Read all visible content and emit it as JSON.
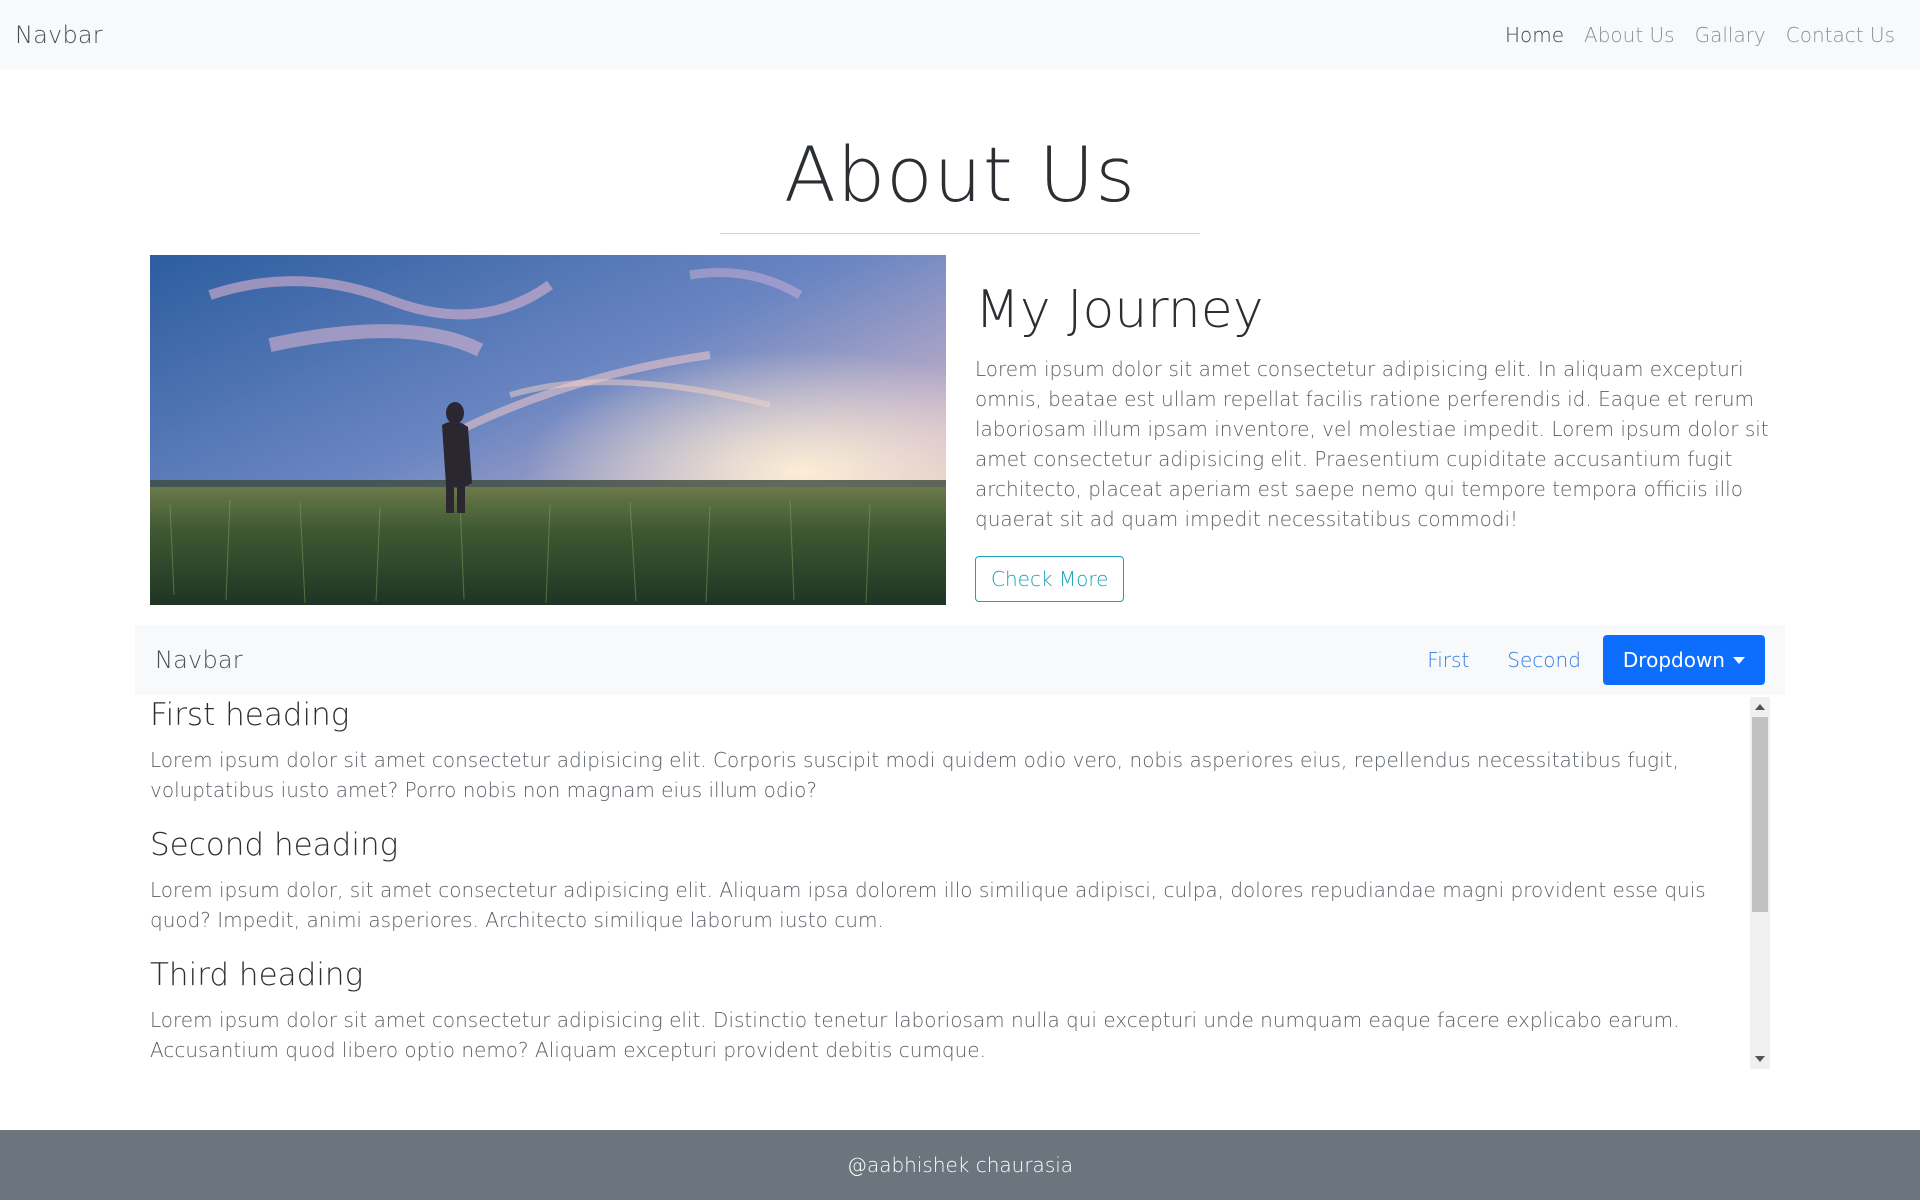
{
  "top_navbar": {
    "brand": "Navbar",
    "links": [
      "Home",
      "About Us",
      "Gallary",
      "Contact Us"
    ]
  },
  "page": {
    "title": "About Us"
  },
  "journey": {
    "heading": "My Journey",
    "text": "Lorem ipsum dolor sit amet consectetur adipisicing elit. In aliquam excepturi omnis, beatae est ullam repellat facilis ratione perferendis id. Eaque et rerum laboriosam illum ipsam inventore, vel molestiae impedit. Lorem ipsum dolor sit amet consectetur adipisicing elit. Praesentium cupiditate accusantium fugit architecto, placeat aperiam est saepe nemo qui tempore tempora officiis illo quaerat sit ad quam impedit necessitatibus commodi!",
    "button": "Check More"
  },
  "sub_navbar": {
    "brand": "Navbar",
    "links": [
      "First",
      "Second"
    ],
    "dropdown": "Dropdown"
  },
  "sections": [
    {
      "heading": "First heading",
      "text": "Lorem ipsum dolor sit amet consectetur adipisicing elit. Corporis suscipit modi quidem odio vero, nobis asperiores eius, repellendus necessitatibus fugit, voluptatibus iusto amet? Porro nobis non magnam eius illum odio?"
    },
    {
      "heading": "Second heading",
      "text": "Lorem ipsum dolor, sit amet consectetur adipisicing elit. Aliquam ipsa dolorem illo similique adipisci, culpa, dolores repudiandae magni provident esse quis quod? Impedit, animi asperiores. Architecto similique laborum iusto cum."
    },
    {
      "heading": "Third heading",
      "text": "Lorem ipsum dolor sit amet consectetur adipisicing elit. Distinctio tenetur laboriosam nulla qui excepturi unde numquam eaque facere explicabo earum. Accusantium quod libero optio nemo? Aliquam excepturi provident debitis cumque."
    }
  ],
  "footer": {
    "text": "@aabhishek chaurasia"
  },
  "colors": {
    "navbar_bg": "#f8f9fa",
    "accent_blue": "#0d6efd",
    "link_blue": "#2f7ae5",
    "info_teal": "#17a2b8",
    "footer_bg": "#6c757d"
  }
}
